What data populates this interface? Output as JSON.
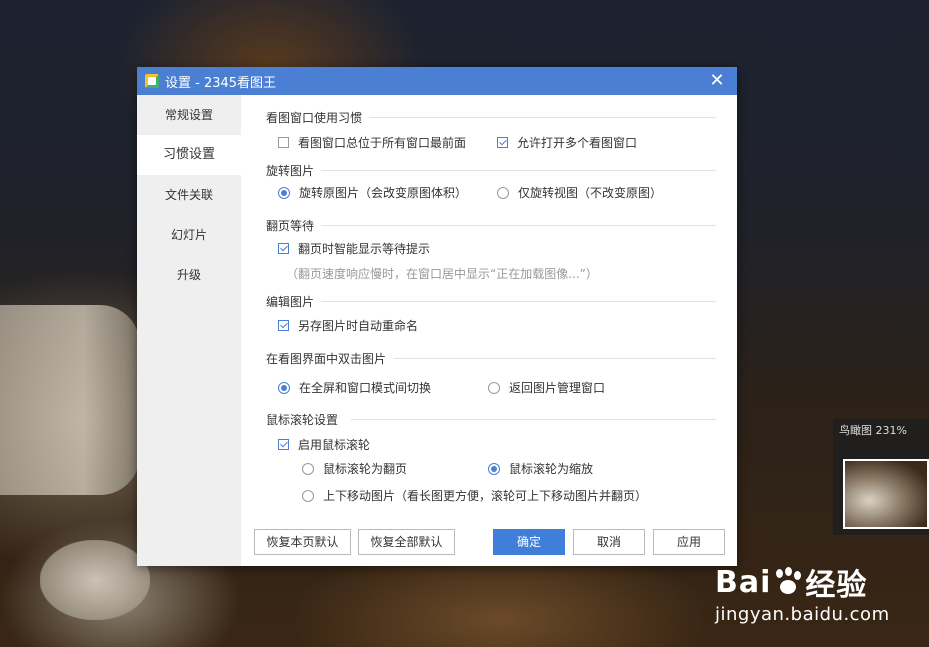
{
  "dialog": {
    "title": "设置 - 2345看图王",
    "close_symbol": "✕"
  },
  "sidebar": {
    "items": [
      {
        "label": "常规设置",
        "active": false
      },
      {
        "label": "习惯设置",
        "active": true
      },
      {
        "label": "文件关联",
        "active": false
      },
      {
        "label": "幻灯片",
        "active": false
      },
      {
        "label": "升级",
        "active": false
      }
    ]
  },
  "sections": {
    "window_habit": {
      "title": "看图窗口使用习惯",
      "always_on_top": {
        "label": "看图窗口总位于所有窗口最前面",
        "checked": false
      },
      "allow_multiple": {
        "label": "允许打开多个看图窗口",
        "checked": true
      }
    },
    "rotate": {
      "title": "旋转图片",
      "rotate_original": {
        "label": "旋转原图片（会改变原图体积）",
        "selected": true
      },
      "rotate_view_only": {
        "label": "仅旋转视图（不改变原图）",
        "selected": false
      }
    },
    "page_wait": {
      "title": "翻页等待",
      "smart_hint": {
        "label": "翻页时智能显示等待提示",
        "checked": true
      },
      "note": "（翻页速度响应慢时，在窗口居中显示“正在加载图像...”）"
    },
    "edit": {
      "title": "编辑图片",
      "auto_rename": {
        "label": "另存图片时自动重命名",
        "checked": true
      }
    },
    "double_click": {
      "title": "在看图界面中双击图片",
      "toggle_fullscreen": {
        "label": "在全屏和窗口模式间切换",
        "selected": true
      },
      "back_to_manager": {
        "label": "返回图片管理窗口",
        "selected": false
      }
    },
    "wheel": {
      "title": "鼠标滚轮设置",
      "enable": {
        "label": "启用鼠标滚轮",
        "checked": true
      },
      "page_turn": {
        "label": "鼠标滚轮为翻页",
        "selected": false
      },
      "zoom": {
        "label": "鼠标滚轮为缩放",
        "selected": true
      },
      "move": {
        "label": "上下移动图片（看长图更方便，滚轮可上下移动图片并翻页）",
        "selected": false
      }
    }
  },
  "buttons": {
    "restore_page": "恢复本页默认",
    "restore_all": "恢复全部默认",
    "ok": "确定",
    "cancel": "取消",
    "apply": "应用"
  },
  "thumbnail": {
    "label": "鸟瞰图 231%"
  },
  "watermark": {
    "logo_left": "Bai",
    "logo_right": "经验",
    "url": "jingyan.baidu.com"
  },
  "colors": {
    "accent": "#4a7fd4",
    "primary_button": "#3f7fd9",
    "sidebar_bg": "#efefef"
  }
}
